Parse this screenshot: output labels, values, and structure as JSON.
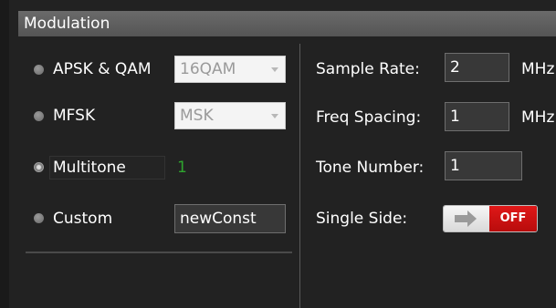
{
  "panel": {
    "title": "Modulation"
  },
  "left": {
    "options": [
      {
        "label": "APSK & QAM",
        "selected": false
      },
      {
        "label": "MFSK",
        "selected": false
      },
      {
        "label": "Multitone",
        "selected": true
      },
      {
        "label": "Custom",
        "selected": false
      }
    ],
    "apsk_combo": {
      "value": "16QAM"
    },
    "mfsk_combo": {
      "value": "MSK"
    },
    "multitone_value": "1",
    "custom_value": "newConst"
  },
  "right": {
    "sample_rate": {
      "label": "Sample Rate:",
      "value": "2",
      "unit": "MHz"
    },
    "freq_spacing": {
      "label": "Freq Spacing:",
      "value": "1",
      "unit": "MHz"
    },
    "tone_number": {
      "label": "Tone Number:",
      "value": "1"
    },
    "single_side": {
      "label": "Single Side:",
      "state": "OFF"
    }
  },
  "colors": {
    "toggle_off": "#d01414",
    "accent_green": "#2fa52f"
  }
}
